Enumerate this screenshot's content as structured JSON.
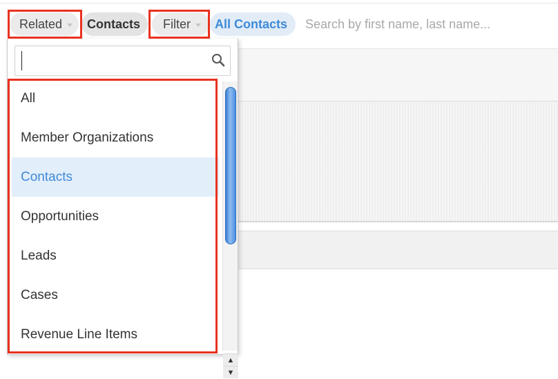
{
  "filter_bar": {
    "related_label": "Related",
    "module_label": "Contacts",
    "filter_label": "Filter",
    "active_filter_label": "All Contacts",
    "search_placeholder": "Search by first name, last name..."
  },
  "dropdown": {
    "search_value": "",
    "search_icon": "magnifier-icon",
    "items": [
      {
        "label": "All"
      },
      {
        "label": "Member Organizations"
      },
      {
        "label": "Contacts"
      },
      {
        "label": "Opportunities"
      },
      {
        "label": "Leads"
      },
      {
        "label": "Cases"
      },
      {
        "label": "Revenue Line Items"
      }
    ],
    "selected_label": "Contacts"
  },
  "colors": {
    "accent": "#3d8ad8",
    "highlight": "#e8321f",
    "selected_bg": "#e3eefb"
  }
}
